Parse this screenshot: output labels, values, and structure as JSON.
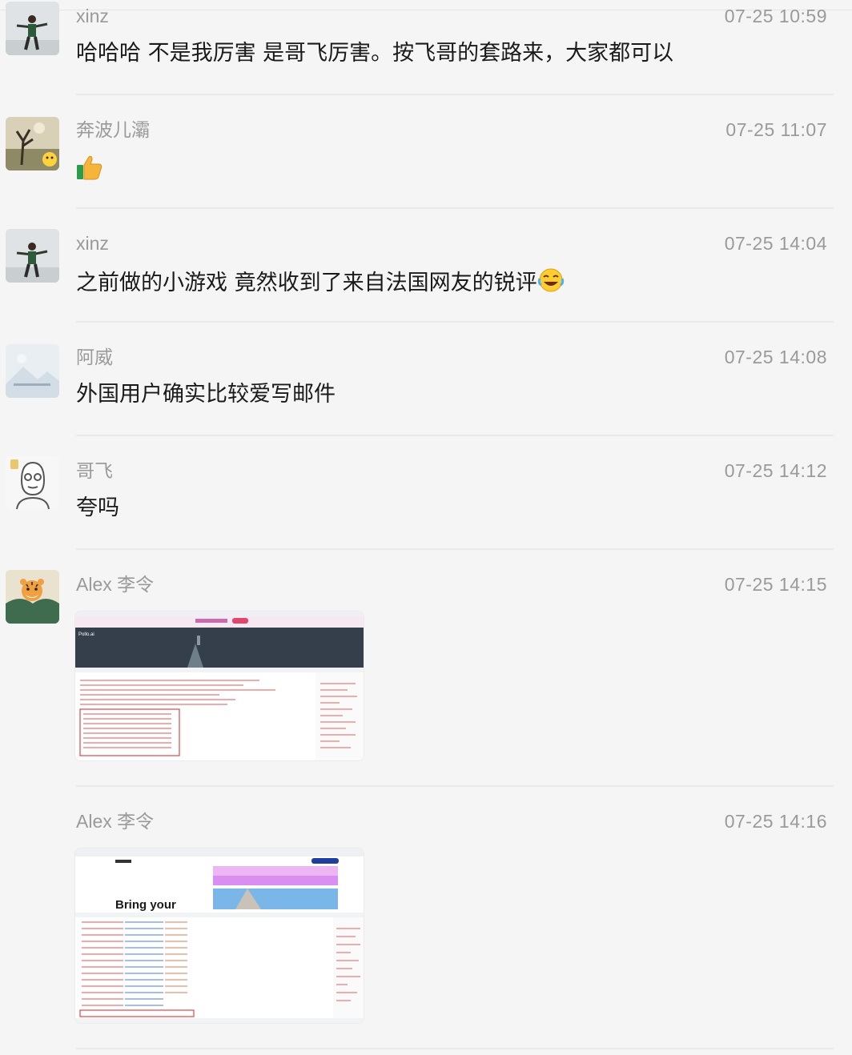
{
  "messages": [
    {
      "sender": "xinz",
      "time": "07-25 10:59",
      "text": "哈哈哈 不是我厉害 是哥飞厉害。按飞哥的套路来，大家都可以"
    },
    {
      "sender": "奔波儿灞",
      "time": "07-25 11:07",
      "emoji": "thumbs-up"
    },
    {
      "sender": "xinz",
      "time": "07-25 14:04",
      "text": "之前做的小游戏 竟然收到了来自法国网友的锐评",
      "emoji": "tears-of-joy"
    },
    {
      "sender": "阿威",
      "time": "07-25 14:08",
      "text": "外国用户确实比较爱写邮件"
    },
    {
      "sender": "哥飞",
      "time": "07-25 14:12",
      "text": "夸吗"
    },
    {
      "sender": "Alex 李令",
      "time": "07-25 14:15",
      "image": {
        "kind": "screenshot",
        "label": "Pollo.ai"
      }
    },
    {
      "sender": "Alex 李令",
      "time": "07-25 14:16",
      "image": {
        "kind": "screenshot",
        "label": "Bring your"
      }
    }
  ],
  "colors": {
    "background": "#f5f5f5",
    "meta_text": "#9a9a9a",
    "body_text": "#1a1a1a",
    "divider": "#e9e9e9"
  }
}
